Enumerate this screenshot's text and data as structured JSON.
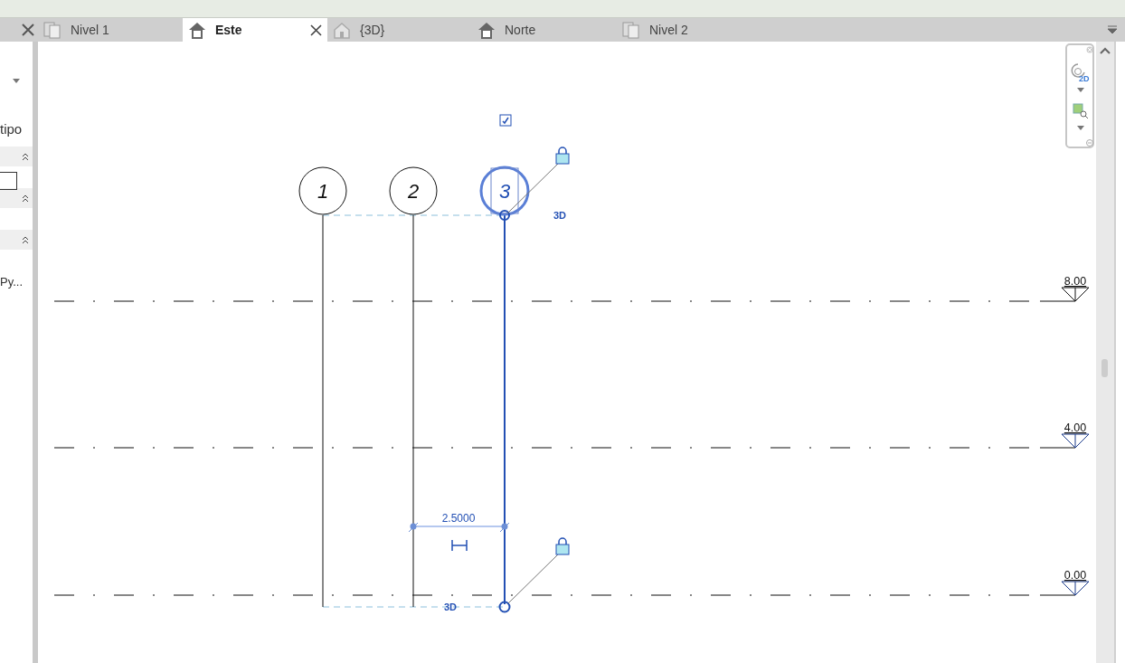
{
  "tabs": [
    {
      "label": "Nivel 1",
      "kind": "plan",
      "selected": false
    },
    {
      "label": "Este",
      "kind": "elevation",
      "selected": true
    },
    {
      "label": "{3D}",
      "kind": "model",
      "selected": false
    },
    {
      "label": "Norte",
      "kind": "elevation",
      "selected": false
    },
    {
      "label": "Nivel 2",
      "kind": "plan",
      "selected": false
    }
  ],
  "properties_panel": {
    "type_label": "tipo",
    "truncated_value": "Py..."
  },
  "navigation_bar": {
    "badge": "2D"
  },
  "grids": [
    {
      "label": "1",
      "selected": false
    },
    {
      "label": "2",
      "selected": false
    },
    {
      "label": "3",
      "selected": true
    }
  ],
  "grid_annotations": [
    "3D",
    "3D"
  ],
  "dimension": {
    "value": "2.5000"
  },
  "levels": [
    {
      "elevation": "8.00"
    },
    {
      "elevation": "4.00"
    },
    {
      "elevation": "0.00"
    }
  ]
}
